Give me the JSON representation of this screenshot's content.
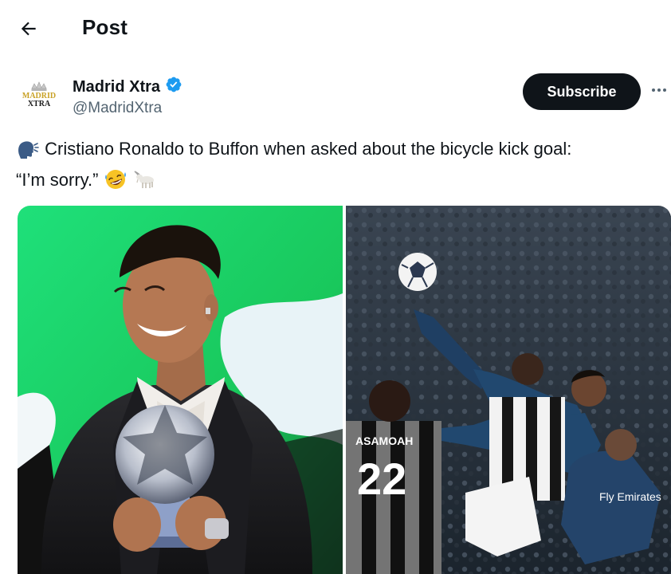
{
  "header": {
    "title": "Post",
    "back_icon": "arrow-left-icon"
  },
  "author": {
    "display_name": "Madrid Xtra",
    "handle": "@MadridXtra",
    "verified": true,
    "verified_color": "#1d9bf0",
    "avatar_text_top": "MADRID",
    "avatar_text_bottom": "XTRA"
  },
  "actions": {
    "subscribe_label": "Subscribe",
    "more_icon": "more-horizontal-icon"
  },
  "tweet": {
    "lead_emoji": "🗣️",
    "text_line1": "Cristiano Ronaldo to Buffon when asked about the bicycle kick goal:",
    "text_line2": "“I’m sorry.”",
    "trailing_emojis": "🤣🐐"
  },
  "media": {
    "photos": [
      {
        "description_icon": "photo-icon"
      },
      {
        "jersey_name": "ASAMOAH",
        "jersey_number": "22",
        "sponsor_text": "Fly Emirates"
      }
    ]
  },
  "colors": {
    "text_primary": "#0f1419",
    "text_secondary": "#536471",
    "button_dark": "#0f1419",
    "accent_blue": "#1d9bf0"
  }
}
